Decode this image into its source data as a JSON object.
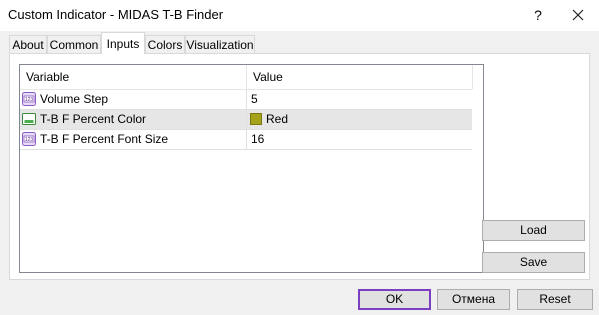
{
  "window": {
    "title": "Custom Indicator - MIDAS T-B Finder",
    "help_label": "?"
  },
  "tabs": [
    {
      "label": "About",
      "active": false
    },
    {
      "label": "Common",
      "active": false
    },
    {
      "label": "Inputs",
      "active": true
    },
    {
      "label": "Colors",
      "active": false
    },
    {
      "label": "Visualization",
      "active": false
    }
  ],
  "grid": {
    "columns": [
      "Variable",
      "Value"
    ],
    "rows": [
      {
        "icon": "numeric-input-icon",
        "name": "Volume Step",
        "value": "5"
      },
      {
        "icon": "color-input-icon",
        "name": "T-B F Percent Color",
        "value": "Red",
        "swatch": "#a5a21b"
      },
      {
        "icon": "numeric-input-icon",
        "name": "T-B F Percent Font Size",
        "value": "16"
      }
    ]
  },
  "side_buttons": {
    "load": "Load",
    "save": "Save"
  },
  "footer_buttons": {
    "ok": "OK",
    "cancel": "Отмена",
    "reset": "Reset"
  },
  "colors": {
    "default_button_border": "#7c3fbf",
    "selected_row": "#e6e6e6"
  }
}
